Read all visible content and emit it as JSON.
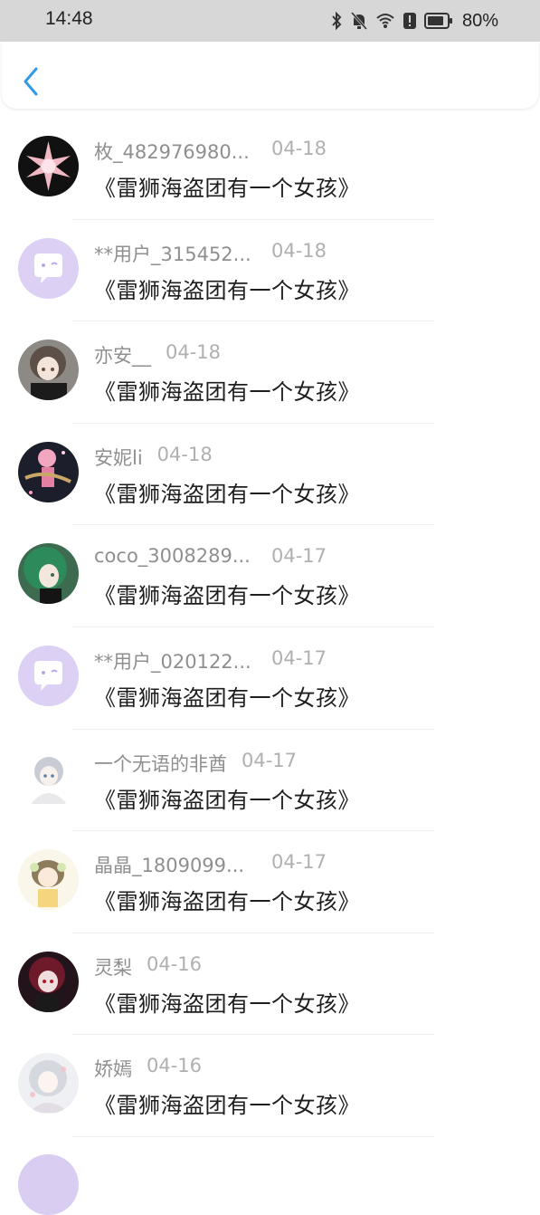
{
  "status_bar": {
    "time": "14:48",
    "battery": "80%",
    "icons": [
      "bluetooth-icon",
      "mute-bell-icon",
      "wifi-icon",
      "alert-icon",
      "battery-icon"
    ]
  },
  "nav": {
    "back_icon": "chevron-left-icon",
    "accent": "#2f9be8"
  },
  "comments": [
    {
      "name": "枚_482976980...",
      "date": "04-18",
      "title": "《雷狮海盗团有一个女孩》",
      "avatar": "dark-star"
    },
    {
      "name": "**用户_315452...",
      "date": "04-18",
      "title": "《雷狮海盗团有一个女孩》",
      "avatar": "default-purple"
    },
    {
      "name": "亦安__",
      "date": "04-18",
      "title": "《雷狮海盗团有一个女孩》",
      "avatar": "anime-brown"
    },
    {
      "name": "安妮li",
      "date": "04-18",
      "title": "《雷狮海盗团有一个女孩》",
      "avatar": "anime-pink"
    },
    {
      "name": "coco_3008289...",
      "date": "04-17",
      "title": "《雷狮海盗团有一个女孩》",
      "avatar": "anime-green"
    },
    {
      "name": "**用户_020122...",
      "date": "04-17",
      "title": "《雷狮海盗团有一个女孩》",
      "avatar": "default-purple"
    },
    {
      "name": "一个无语的非酋",
      "date": "04-17",
      "title": "《雷狮海盗团有一个女孩》",
      "avatar": "anime-white"
    },
    {
      "name": "晶晶_1809099...",
      "date": "04-17",
      "title": "《雷狮海盗团有一个女孩》",
      "avatar": "anime-cream"
    },
    {
      "name": "灵梨",
      "date": "04-16",
      "title": "《雷狮海盗团有一个女孩》",
      "avatar": "anime-red"
    },
    {
      "name": "娇嫣",
      "date": "04-16",
      "title": "《雷狮海盗团有一个女孩》",
      "avatar": "anime-silver"
    }
  ]
}
